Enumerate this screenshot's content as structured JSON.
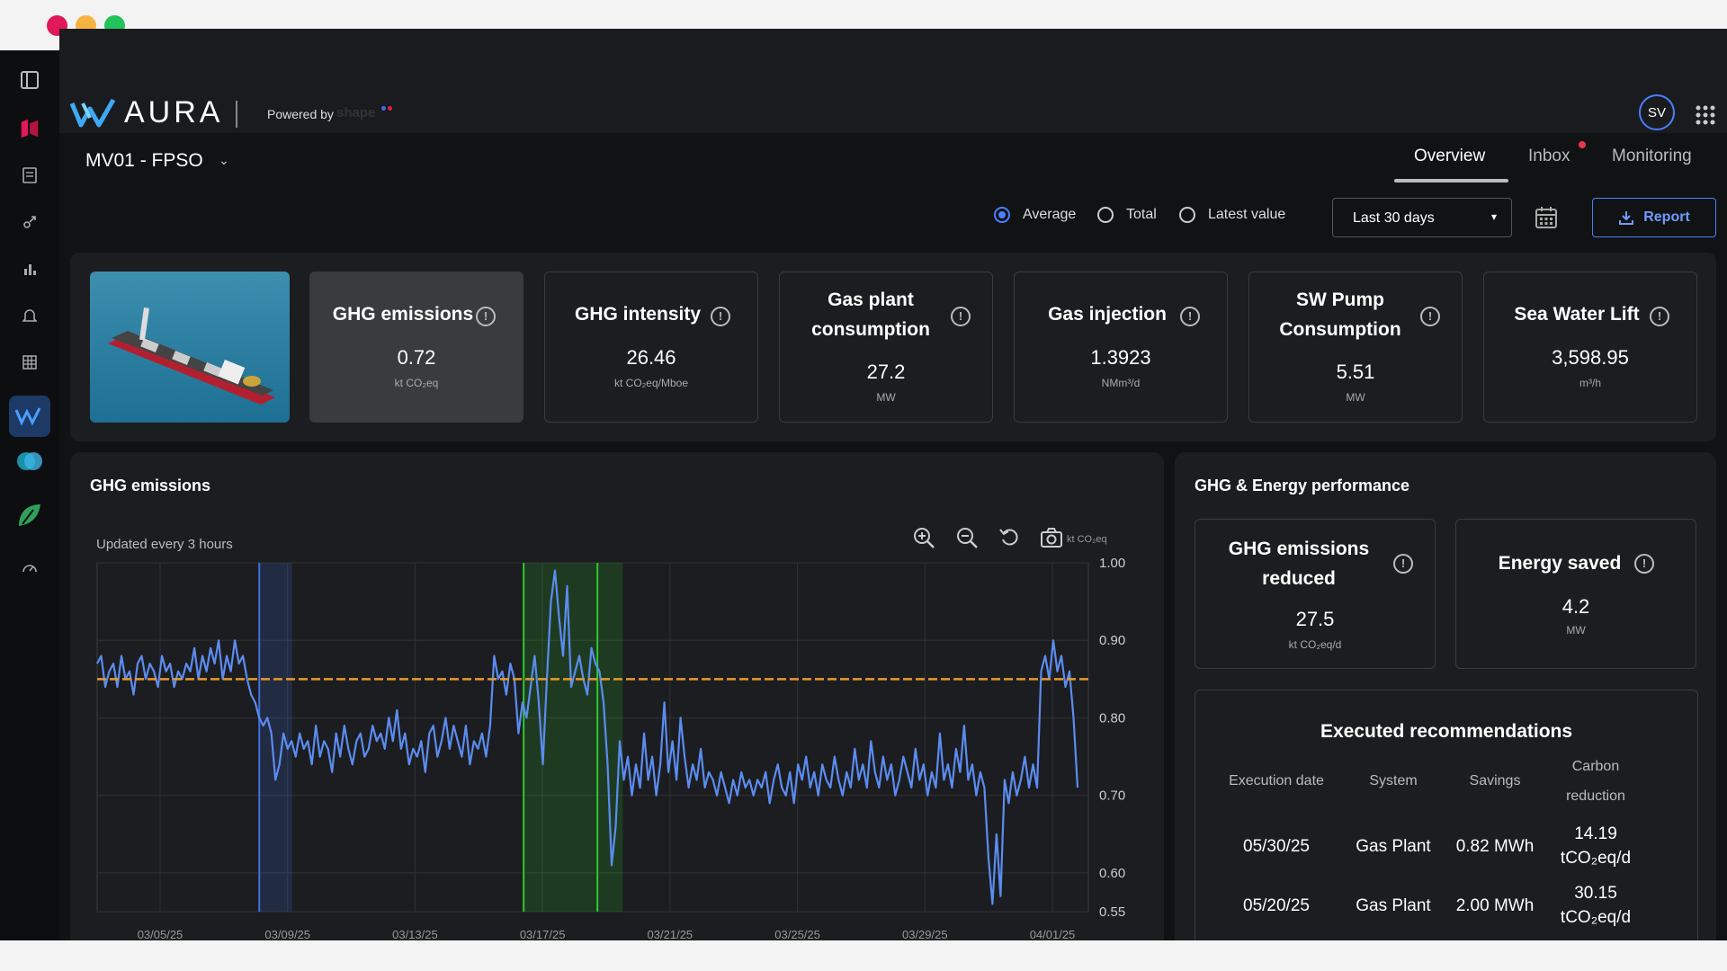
{
  "brand": {
    "name": "AURA",
    "powered_by": "Powered by",
    "powered_logo": "shape"
  },
  "asset": {
    "name": "MV01 - FPSO"
  },
  "user": {
    "initials": "SV"
  },
  "tabs": [
    {
      "label": "Overview"
    },
    {
      "label": "Inbox"
    },
    {
      "label": "Monitoring"
    }
  ],
  "controls": {
    "radios": [
      {
        "label": "Average",
        "checked": true
      },
      {
        "label": "Total",
        "checked": false
      },
      {
        "label": "Latest value",
        "checked": false
      }
    ],
    "period": "Last 30 days",
    "report_label": "Report"
  },
  "kpis": [
    {
      "title": "GHG emissions",
      "value": "0.72",
      "unit": "kt CO₂eq",
      "selected": true
    },
    {
      "title": "GHG intensity",
      "value": "26.46",
      "unit": "kt CO₂eq/Mboe",
      "selected": false
    },
    {
      "title": "Gas plant consumption",
      "value": "27.2",
      "unit": "MW",
      "selected": false
    },
    {
      "title": "Gas injection",
      "value": "1.3923",
      "unit": "NMm³/d",
      "selected": false
    },
    {
      "title": "SW Pump Consumption",
      "value": "5.51",
      "unit": "MW",
      "selected": false
    },
    {
      "title": "Sea Water Lift",
      "value": "3,598.95",
      "unit": "m³/h",
      "selected": false
    }
  ],
  "ghg_panel": {
    "title": "GHG emissions",
    "updated": "Updated every 3 hours"
  },
  "chart_data": {
    "type": "line",
    "unit_label": "kt CO₂eq",
    "ylim": [
      0.55,
      1.0
    ],
    "y_ticks": [
      "1.00",
      "0.90",
      "0.80",
      "0.70",
      "0.60",
      "0.55"
    ],
    "x_ticks": [
      "03/05/25",
      "03/09/25",
      "03/13/25",
      "03/17/25",
      "03/21/25",
      "03/25/25",
      "03/29/25",
      "04/01/25"
    ],
    "reference_line": 0.85,
    "series": [
      {
        "values": [
          0.87,
          0.88,
          0.84,
          0.86,
          0.87,
          0.84,
          0.88,
          0.85,
          0.86,
          0.83,
          0.87,
          0.88,
          0.85,
          0.87,
          0.86,
          0.84,
          0.88,
          0.86,
          0.87,
          0.84,
          0.86,
          0.85,
          0.87,
          0.86,
          0.89,
          0.85,
          0.88,
          0.86,
          0.89,
          0.87,
          0.9,
          0.85,
          0.88,
          0.86,
          0.9,
          0.87,
          0.88,
          0.85,
          0.83,
          0.82,
          0.8,
          0.79,
          0.8,
          0.78,
          0.72,
          0.74,
          0.78,
          0.76,
          0.77,
          0.75,
          0.78,
          0.76,
          0.77,
          0.74,
          0.79,
          0.75,
          0.77,
          0.76,
          0.73,
          0.78,
          0.75,
          0.79,
          0.76,
          0.74,
          0.77,
          0.78,
          0.75,
          0.76,
          0.79,
          0.77,
          0.78,
          0.76,
          0.8,
          0.77,
          0.81,
          0.76,
          0.78,
          0.74,
          0.76,
          0.75,
          0.77,
          0.73,
          0.78,
          0.79,
          0.75,
          0.77,
          0.8,
          0.76,
          0.79,
          0.77,
          0.75,
          0.79,
          0.74,
          0.77,
          0.76,
          0.78,
          0.75,
          0.79,
          0.88,
          0.85,
          0.86,
          0.83,
          0.87,
          0.85,
          0.78,
          0.82,
          0.8,
          0.84,
          0.88,
          0.82,
          0.74,
          0.85,
          0.95,
          0.99,
          0.93,
          0.88,
          0.97,
          0.84,
          0.86,
          0.88,
          0.85,
          0.83,
          0.89,
          0.87,
          0.86,
          0.82,
          0.74,
          0.61,
          0.66,
          0.77,
          0.72,
          0.75,
          0.7,
          0.74,
          0.71,
          0.78,
          0.72,
          0.75,
          0.7,
          0.74,
          0.82,
          0.73,
          0.77,
          0.72,
          0.8,
          0.75,
          0.71,
          0.74,
          0.72,
          0.76,
          0.71,
          0.73,
          0.72,
          0.7,
          0.73,
          0.71,
          0.69,
          0.72,
          0.7,
          0.73,
          0.71,
          0.72,
          0.7,
          0.72,
          0.71,
          0.73,
          0.69,
          0.72,
          0.74,
          0.71,
          0.7,
          0.73,
          0.69,
          0.74,
          0.72,
          0.75,
          0.71,
          0.73,
          0.7,
          0.74,
          0.72,
          0.71,
          0.75,
          0.72,
          0.7,
          0.73,
          0.71,
          0.76,
          0.72,
          0.74,
          0.71,
          0.77,
          0.73,
          0.71,
          0.75,
          0.72,
          0.74,
          0.7,
          0.72,
          0.75,
          0.73,
          0.71,
          0.76,
          0.72,
          0.74,
          0.7,
          0.73,
          0.71,
          0.78,
          0.72,
          0.74,
          0.71,
          0.76,
          0.73,
          0.79,
          0.72,
          0.74,
          0.7,
          0.73,
          0.71,
          0.62,
          0.56,
          0.65,
          0.57,
          0.72,
          0.69,
          0.73,
          0.7,
          0.72,
          0.75,
          0.71,
          0.74,
          0.71,
          0.86,
          0.88,
          0.85,
          0.9,
          0.86,
          0.88,
          0.84,
          0.86,
          0.8,
          0.71
        ]
      }
    ],
    "markers": [
      {
        "type": "blue",
        "from": "03/08/25",
        "to": "03/09/25"
      },
      {
        "type": "green",
        "from": "03/16/25",
        "to": "03/19/25"
      }
    ]
  },
  "perf_panel": {
    "title": "GHG & Energy performance",
    "cards": [
      {
        "title": "GHG emissions reduced",
        "value": "27.5",
        "unit": "kt CO₂eq/d"
      },
      {
        "title": "Energy saved",
        "value": "4.2",
        "unit": "MW"
      }
    ],
    "recommendations": {
      "title": "Executed recommendations",
      "headers": [
        "Execution date",
        "System",
        "Savings",
        "Carbon reduction"
      ],
      "rows": [
        {
          "date": "05/30/25",
          "system": "Gas Plant",
          "savings": "0.82 MWh",
          "carbon": "14.19 tCO₂eq/d"
        },
        {
          "date": "05/20/25",
          "system": "Gas Plant",
          "savings": "2.00 MWh",
          "carbon": "30.15 tCO₂eq/d"
        }
      ]
    }
  },
  "colors": {
    "accent": "#4a7fff",
    "series": "#5b8cf0",
    "reference": "#e79a2a",
    "green_marker": "#2fc72f",
    "blue_marker": "#3f6fe0"
  }
}
